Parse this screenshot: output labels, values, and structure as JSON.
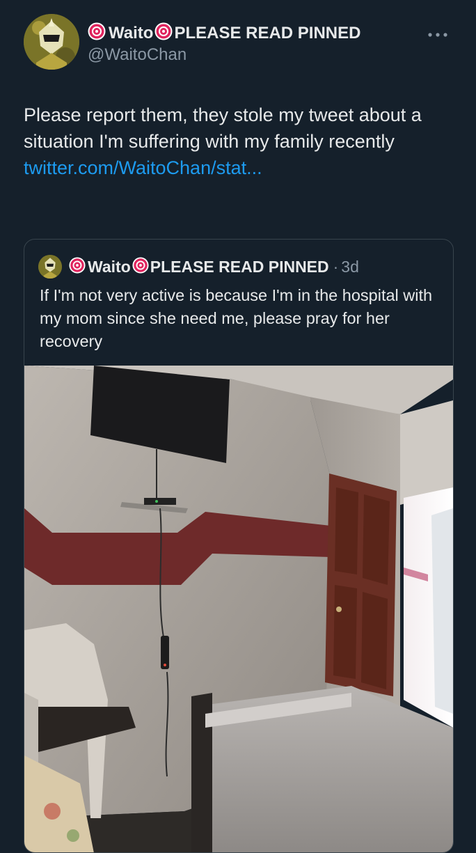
{
  "tweet": {
    "display_name": "Waito",
    "name_suffix": "PLEASE READ PINNED",
    "handle": "@WaitoChan",
    "more_icon": "more-icon",
    "text": "Please report them, they stole my tweet about a situation I'm suffering with my family recently",
    "link": "twitter.com/WaitoChan/stat..."
  },
  "quoted": {
    "display_name": "Waito",
    "name_suffix": "PLEASE READ PINNED",
    "timestamp": "3d",
    "separator": "·",
    "text": "If I'm not very active is because I'm in the hospital with my mom since she need me, please pray for her recovery"
  },
  "colors": {
    "background": "#15202b",
    "link": "#1d9bf0",
    "secondary_text": "#8b98a5",
    "badge": "#e0245e"
  }
}
